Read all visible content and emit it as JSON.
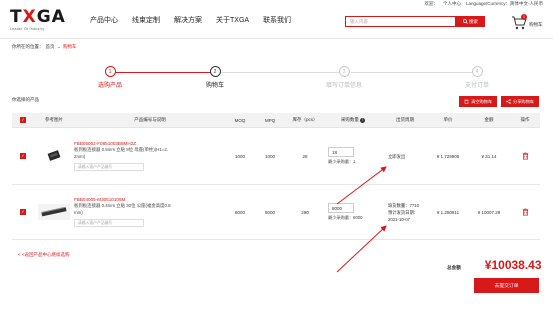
{
  "topbar": {
    "welcome": "欢迎：",
    "personal_center": "个人中心",
    "language_label": "Language/Currency：简体中文-人民币"
  },
  "header": {
    "logo_text_1": "T",
    "logo_text_x": "X",
    "logo_text_2": "GA",
    "logo_tagline": "Leader Of Industry",
    "nav": [
      "产品中心",
      "线束定制",
      "解决方案",
      "关于TXGA",
      "联系我们"
    ],
    "search_placeholder": "输入内容",
    "search_button": "搜索",
    "cart_count": "1",
    "cart_label": "购物车"
  },
  "breadcrumb": {
    "prefix": "你所在的位置：",
    "home": "首页",
    "sep": "→",
    "current": "购物车"
  },
  "steps": [
    {
      "num": "1",
      "label": "选购产品"
    },
    {
      "num": "2",
      "label": "购物车"
    },
    {
      "num": "3",
      "label": "填写订单信息"
    },
    {
      "num": "4",
      "label": "支付订单"
    }
  ],
  "section": {
    "title": "你选择的产品",
    "delete_btn": "清空购物车",
    "share_btn": "分享购物车"
  },
  "table": {
    "headers": [
      "",
      "参考图片",
      "产品编号与说明",
      "MOQ",
      "MPQ",
      "库存（pcs）",
      "采购数量",
      "出货周期",
      "单价",
      "金额",
      "操作"
    ],
    "rows": [
      {
        "part_no": "FBB05002-F0851003B8MH2Z",
        "desc_1": "板到板连接器 0.5mm 立贴 8位 母座(单柱)(H1=2.",
        "desc_2": "2mm)",
        "note_placeholder": "请输入客户产品编号",
        "moq": "1000",
        "mpq": "1000",
        "stock": "28",
        "qty": "18",
        "min_qty": "最少采购量：1",
        "ship_1": "立即发出",
        "ship_2": "",
        "ship_3": "",
        "price": "¥ 1.729905",
        "amount": "¥ 31.14"
      },
      {
        "part_no": "FBB04005-M30510106M",
        "desc_1": "板到板连接器 0.4mm 立贴 30位 公座(福金高度0.8",
        "desc_2": "mm)",
        "note_placeholder": "请输入客户产品编号",
        "moq": "8000",
        "mpq": "8000",
        "stock": "290",
        "qty": "8000",
        "min_qty": "最少采购量：8000",
        "ship_1": "缺货数量：7710",
        "ship_2": "预计发货日期：",
        "ship_3": "2021-10-07",
        "price": "¥ 1.250911",
        "amount": "¥ 10007.29"
      }
    ]
  },
  "footer": {
    "continue": "< <返回产品中心继续选购",
    "total_label": "总金额",
    "total_value": "¥10038.43",
    "submit": "去提交订单"
  },
  "colors": {
    "accent": "#d7191a",
    "header_bg": "#f2f2f2"
  }
}
